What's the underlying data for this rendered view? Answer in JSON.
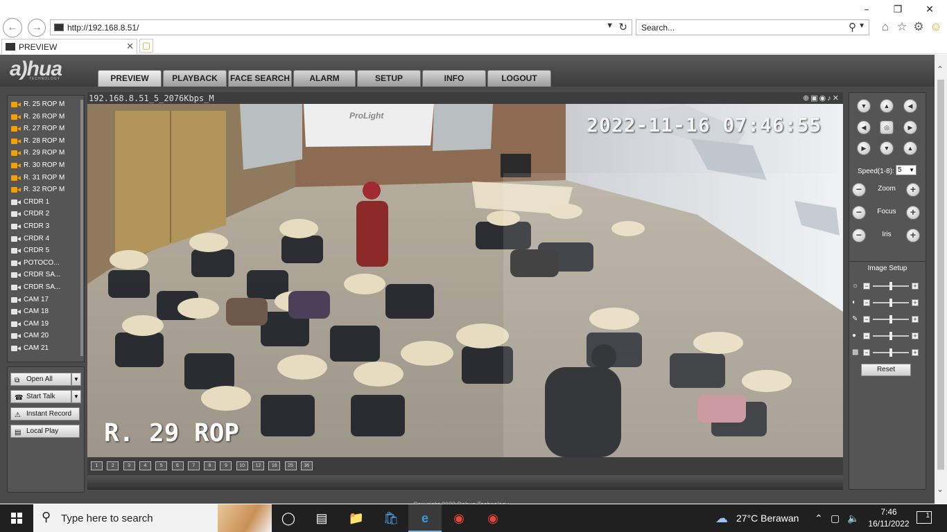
{
  "browser": {
    "url": "http://192.168.8.51/",
    "search_placeholder": "Search...",
    "tab_title": "PREVIEW"
  },
  "app": {
    "logo": "a)hua",
    "logo_sub": "TECHNOLOGY",
    "menu": [
      "PREVIEW",
      "PLAYBACK",
      "FACE SEARCH",
      "ALARM",
      "SETUP",
      "INFO",
      "LOGOUT"
    ],
    "active_menu": "PREVIEW"
  },
  "channels": [
    {
      "label": "R. 25 ROP   M",
      "state": "live"
    },
    {
      "label": "R. 26 ROP   M",
      "state": "live"
    },
    {
      "label": "R. 27 ROP   M",
      "state": "live"
    },
    {
      "label": "R. 28 ROP   M",
      "state": "live"
    },
    {
      "label": "R. 29 ROP   M",
      "state": "live"
    },
    {
      "label": "R. 30 ROP   M",
      "state": "live"
    },
    {
      "label": "R. 31 ROP   M",
      "state": "live"
    },
    {
      "label": "R. 32 ROP   M",
      "state": "live"
    },
    {
      "label": "CRDR 1",
      "state": "idle"
    },
    {
      "label": "CRDR 2",
      "state": "idle"
    },
    {
      "label": "CRDR 3",
      "state": "idle"
    },
    {
      "label": "CRDR 4",
      "state": "idle"
    },
    {
      "label": "CRDR 5",
      "state": "idle"
    },
    {
      "label": "POTOCO...",
      "state": "idle"
    },
    {
      "label": "CRDR SA...",
      "state": "idle"
    },
    {
      "label": "CRDR SA...",
      "state": "idle"
    },
    {
      "label": "CAM 17",
      "state": "idle"
    },
    {
      "label": "CAM 18",
      "state": "idle"
    },
    {
      "label": "CAM 19",
      "state": "idle"
    },
    {
      "label": "CAM 20",
      "state": "idle"
    },
    {
      "label": "CAM 21",
      "state": "idle"
    }
  ],
  "actions": {
    "open_all": "Open All",
    "start_talk": "Start Talk",
    "instant_record": "Instant Record",
    "local_play": "Local Play"
  },
  "video": {
    "stream_title": "192.168.8.51_5_2076Kbps_M",
    "timestamp": "2022-11-16 07:46:55",
    "channel_name": "R. 29 ROP",
    "projector_text": "ProLight"
  },
  "layouts": [
    "1",
    "2",
    "3",
    "4",
    "5",
    "6",
    "7",
    "8",
    "9",
    "10",
    "12",
    "16",
    "25",
    "36"
  ],
  "ptz": {
    "speed_label": "Speed(1-8):",
    "speed_value": "5",
    "zoom": "Zoom",
    "focus": "Focus",
    "iris": "Iris"
  },
  "image_setup": {
    "title": "Image Setup",
    "reset": "Reset",
    "rows": [
      "brightness-icon",
      "contrast-icon",
      "saturation-icon",
      "hue-icon",
      "gain-icon"
    ]
  },
  "footer": "Copyright 2022 Dahua Technology",
  "taskbar": {
    "search_placeholder": "Type here to search",
    "weather": "27°C  Berawan",
    "time": "7:46",
    "date": "16/11/2022",
    "notifications": "1"
  },
  "colors": {
    "live_camera": "#f5a000",
    "page_bg": "#4a4a4a",
    "taskbar_bg": "#202020"
  }
}
